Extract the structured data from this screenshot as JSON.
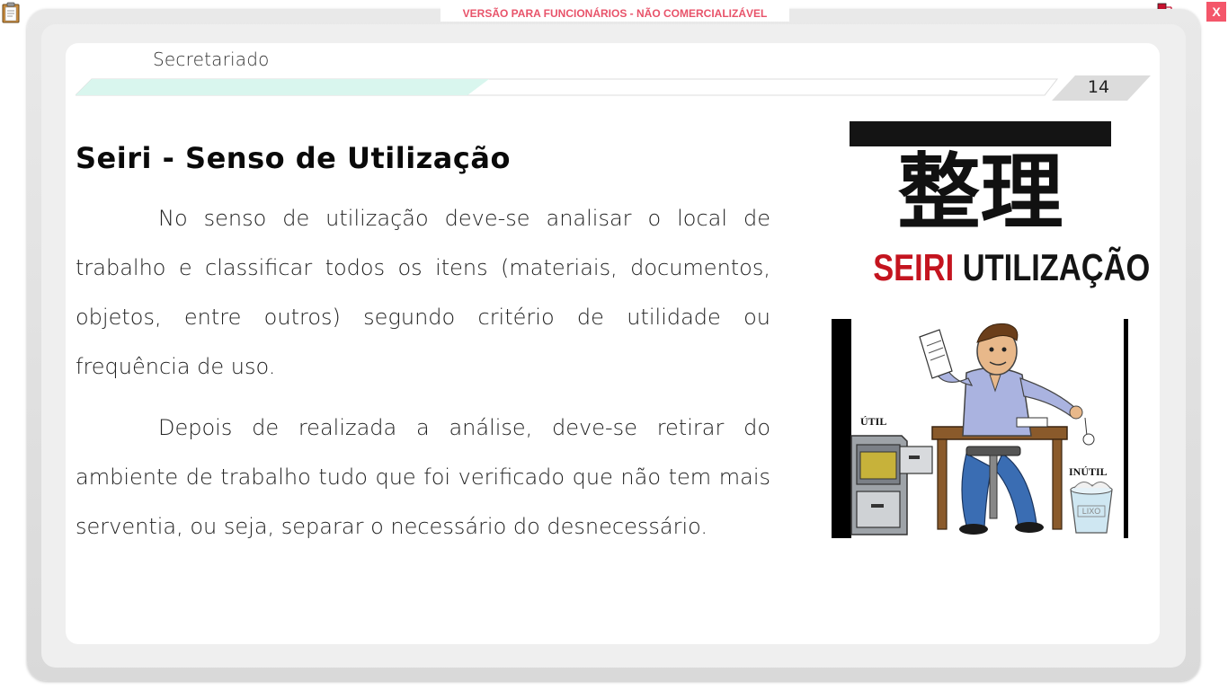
{
  "banner": {
    "text": "VERSÃO PARA FUNCIONÁRIOS - NÃO COMERCIALIZÁVEL"
  },
  "toolbar": {
    "close_label": "X",
    "clipboard_icon": "clipboard-icon",
    "network_icon": "network-status-icon"
  },
  "header": {
    "title": "Secretariado",
    "page_number": "14"
  },
  "content": {
    "heading": "Seiri - Senso de Utilização",
    "paragraphs": [
      "No senso de utilização deve-se analisar o local de trabalho e classificar todos os itens (materiais, documentos, objetos, entre outros) segundo critério de utilidade ou frequência de uso.",
      "Depois de realizada a análise, deve-se retirar do ambiente de trabalho tudo que foi verificado que não tem mais serventia, ou seja, separar o necessário do desnecessário."
    ]
  },
  "figure": {
    "kanji": "整理",
    "caption_red": "SEIRI",
    "caption_black": "UTILIZAÇÃO",
    "cartoon_labels": {
      "util": "ÚTIL",
      "inutil": "INÚTIL",
      "lixo": "LIXO"
    }
  },
  "colors": {
    "banner_text": "#e8536a",
    "close_button": "#f4566a",
    "accent_teal": "#d6f5ec",
    "seiri_red": "#c4141f"
  }
}
